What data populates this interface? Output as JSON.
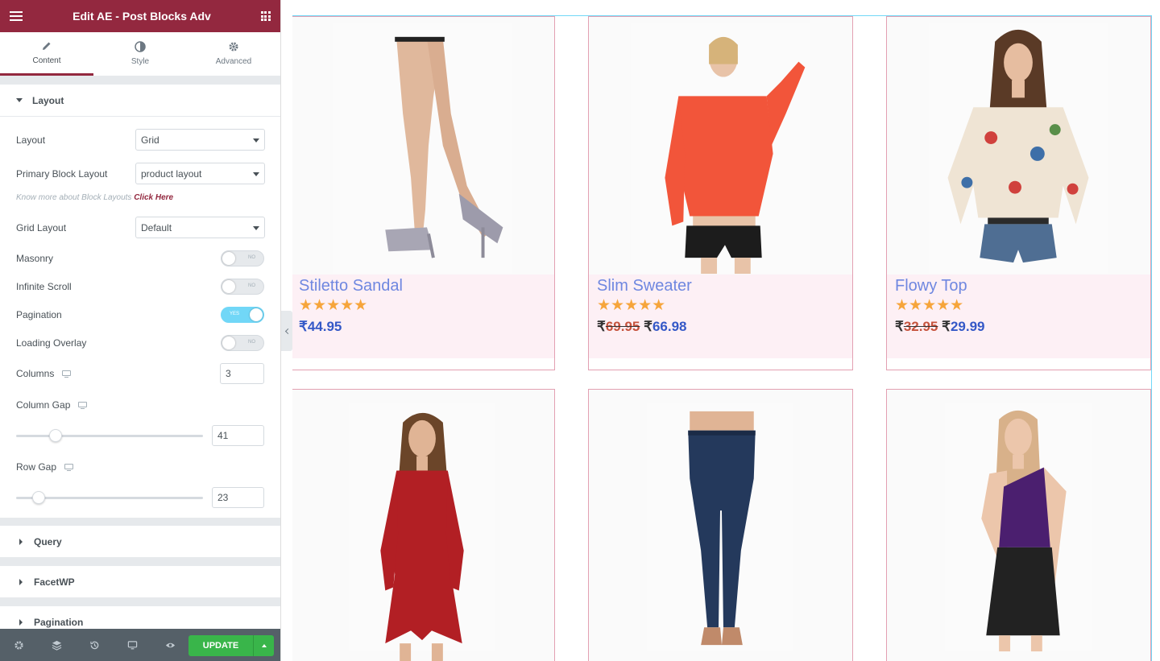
{
  "topbar": {
    "title": "Edit AE - Post Blocks Adv"
  },
  "tabs": [
    {
      "label": "Content",
      "icon": "pencil-icon",
      "active": true
    },
    {
      "label": "Style",
      "icon": "contrast-icon",
      "active": false
    },
    {
      "label": "Advanced",
      "icon": "gear-icon",
      "active": false
    }
  ],
  "layout_section": {
    "title": "Layout",
    "layout": {
      "label": "Layout",
      "value": "Grid"
    },
    "primary_block_layout": {
      "label": "Primary Block Layout",
      "value": "product layout"
    },
    "hint": {
      "text": "Know more about Block Layouts",
      "link": "Click Here"
    },
    "grid_layout": {
      "label": "Grid Layout",
      "value": "Default"
    },
    "masonry": {
      "label": "Masonry",
      "state": "NO"
    },
    "infinite_scroll": {
      "label": "Infinite Scroll",
      "state": "NO"
    },
    "pagination": {
      "label": "Pagination",
      "state": "YES"
    },
    "loading_overlay": {
      "label": "Loading Overlay",
      "state": "NO"
    },
    "columns": {
      "label": "Columns",
      "value": "3"
    },
    "column_gap": {
      "label": "Column Gap",
      "value": "41",
      "slider_fraction": 0.21
    },
    "row_gap": {
      "label": "Row Gap",
      "value": "23",
      "slider_fraction": 0.12
    }
  },
  "sections": {
    "query": "Query",
    "facetwp": "FacetWP",
    "pagination": "Pagination"
  },
  "bottombar": {
    "update_label": "UPDATE"
  },
  "colors": {
    "brand": "#93283f",
    "toggle_on": "#71d7f7",
    "update_green": "#39b54a",
    "card_border": "#e3a0b2",
    "card_info_bg": "#fdf0f5",
    "title_blue": "#6f87e0",
    "star": "#f6a53b"
  },
  "products": [
    {
      "title": "Stiletto Sandal",
      "stars": "★★★★★",
      "currency": "₹",
      "old_price": "",
      "price": "44.95",
      "image": "sandal-legs"
    },
    {
      "title": "Slim Sweater",
      "stars": "★★★★★",
      "currency": "₹",
      "old_price": "69.95",
      "price": "66.98",
      "image": "sweater-model"
    },
    {
      "title": "Flowy Top",
      "stars": "★★★★★",
      "currency": "₹",
      "old_price": "32.95",
      "price": "29.99",
      "image": "floral-top-model"
    },
    {
      "title": "",
      "stars": "",
      "currency": "",
      "old_price": "",
      "price": "",
      "image": "red-dress-model"
    },
    {
      "title": "",
      "stars": "",
      "currency": "",
      "old_price": "",
      "price": "",
      "image": "jeans-model"
    },
    {
      "title": "",
      "stars": "",
      "currency": "",
      "old_price": "",
      "price": "",
      "image": "purple-top-model"
    }
  ]
}
